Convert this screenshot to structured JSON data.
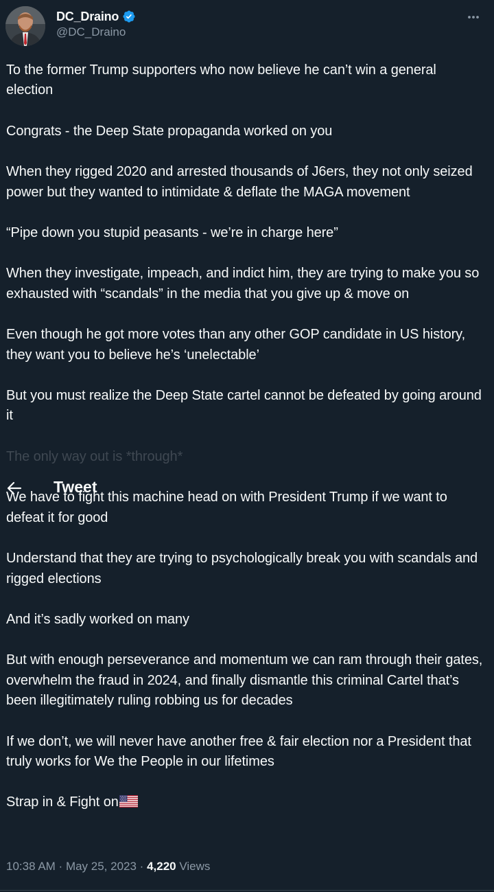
{
  "author": {
    "display_name": "DC_Draino",
    "handle": "@DC_Draino",
    "verified_icon": "verified-badge-icon",
    "verified_color": "#1d9bf0"
  },
  "header": {
    "title": "Tweet",
    "back_icon": "arrow-left-icon"
  },
  "more_icon": "more-horizontal-icon",
  "tweet": {
    "paragraphs": [
      "To the former Trump supporters who now believe he can’t win a general election",
      "Congrats - the Deep State propaganda worked on you",
      "When they rigged 2020 and arrested thousands of J6ers, they not only seized power but they wanted to intimidate & deflate the MAGA movement",
      "“Pipe down you stupid peasants - we’re in charge here”",
      "When they investigate, impeach, and indict him, they are trying to make you so exhausted with “scandals” in the media that you give up & move on",
      "Even though he got more votes than any other GOP candidate in US history, they want you to believe he’s ‘unelectable’",
      "But you must realize the Deep State cartel cannot be defeated by going around it",
      "The only way out is *through*",
      "We have to fight this machine head on with President Trump if we want to defeat it for good",
      "Understand that they are trying to psychologically break you with scandals and rigged elections",
      "And it’s sadly worked on many",
      "But with enough perseverance and momentum we can ram through their gates, overwhelm the fraud in 2024, and finally dismantle this criminal Cartel that’s been illegitimately ruling robbing us for decades",
      "If we don’t, we will never have another free & fair election nor a President that truly works for We the People in our lifetimes",
      "Strap in & Fight on"
    ],
    "flag_icon": "us-flag-icon"
  },
  "meta": {
    "time": "10:38 AM",
    "date": "May 25, 2023",
    "separator": " · ",
    "views_count": "4,220",
    "views_label": "Views"
  },
  "colors": {
    "background": "#15202b",
    "text": "#f7f9f9",
    "secondary": "#8b98a5"
  }
}
